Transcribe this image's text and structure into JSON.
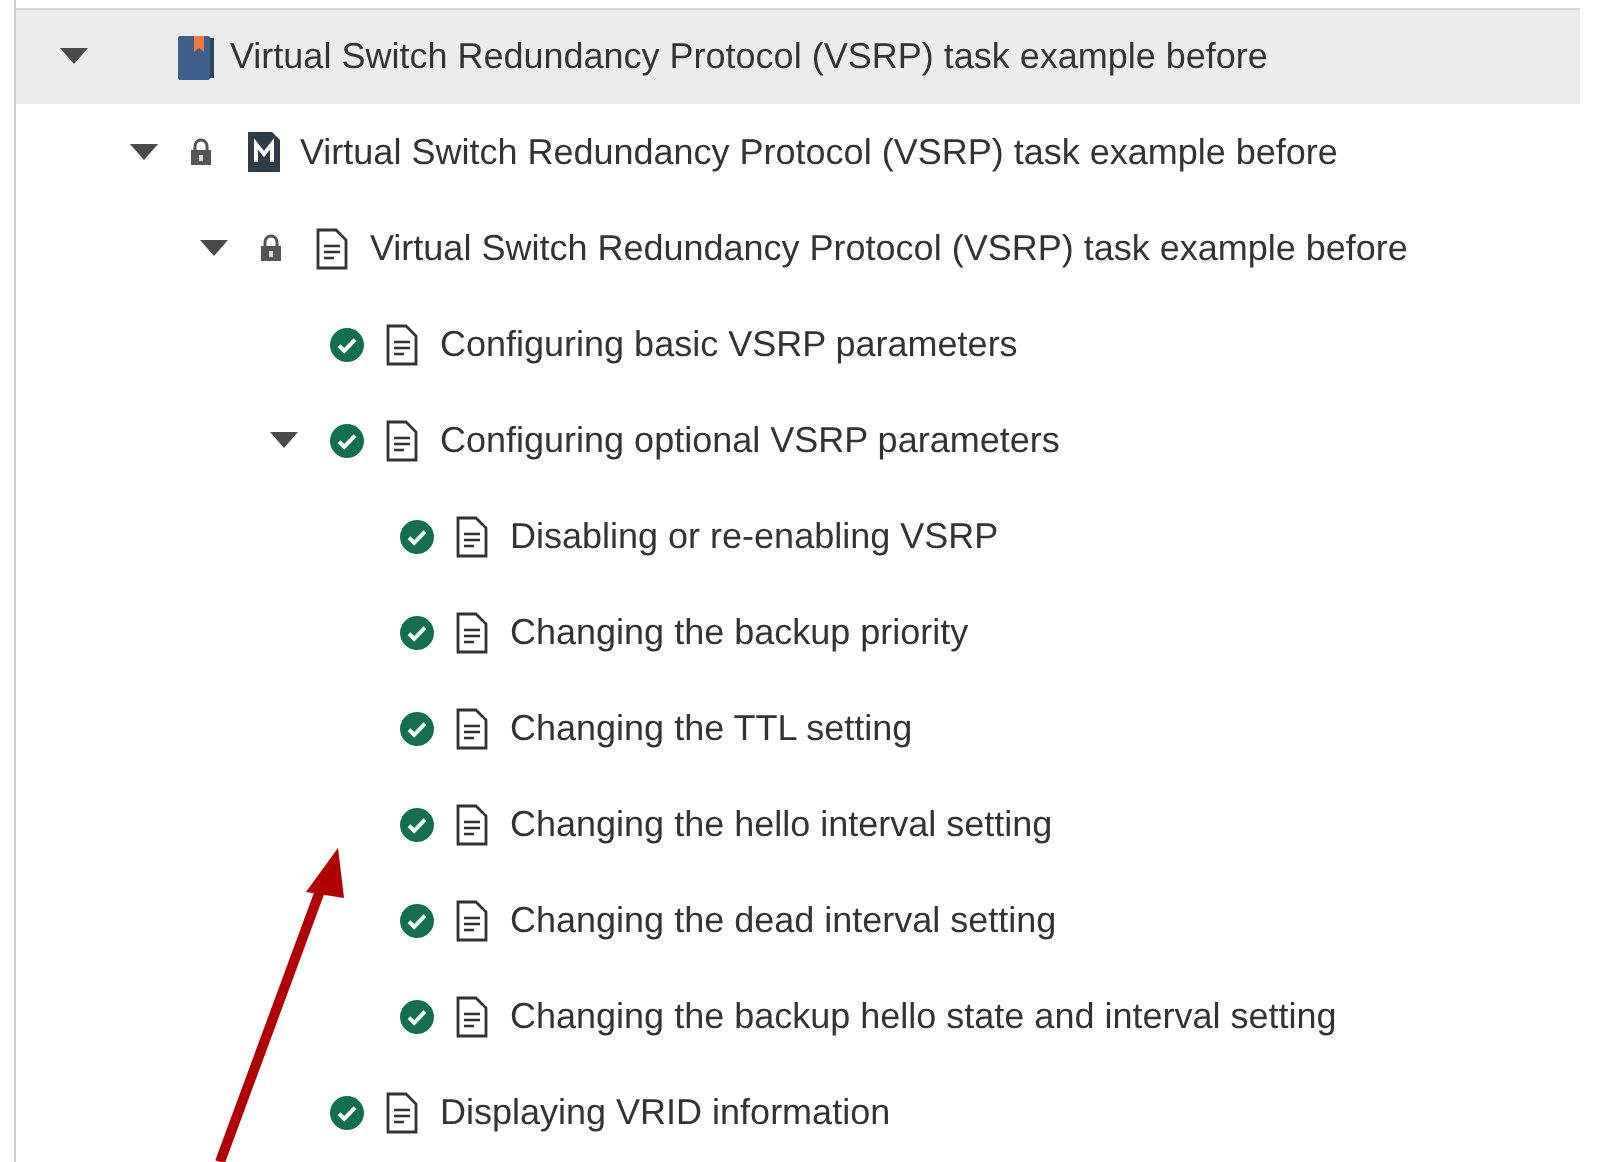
{
  "tree": [
    {
      "label": "Virtual Switch Redundancy Protocol (VSRP) task example before",
      "kind": "book",
      "selected": true,
      "expanded": true,
      "children": [
        {
          "label": "Virtual Switch Redundancy Protocol (VSRP) task example before",
          "kind": "module",
          "locked": true,
          "selected": false,
          "expanded": true,
          "children": [
            {
              "label": "Virtual Switch Redundancy Protocol (VSRP) task example before",
              "kind": "topic",
              "locked": true,
              "selected": false,
              "expanded": true,
              "children": [
                {
                  "label": "Configuring basic VSRP parameters",
                  "kind": "topic",
                  "done": true,
                  "selected": false
                },
                {
                  "label": "Configuring optional VSRP parameters",
                  "kind": "topic",
                  "done": true,
                  "selected": false,
                  "expanded": true,
                  "children": [
                    {
                      "label": "Disabling or re-enabling VSRP",
                      "kind": "topic",
                      "done": true,
                      "selected": false
                    },
                    {
                      "label": "Changing the backup priority",
                      "kind": "topic",
                      "done": true,
                      "selected": false
                    },
                    {
                      "label": "Changing the TTL setting",
                      "kind": "topic",
                      "done": true,
                      "selected": false
                    },
                    {
                      "label": "Changing the hello interval setting",
                      "kind": "topic",
                      "done": true,
                      "selected": false
                    },
                    {
                      "label": "Changing the dead interval setting",
                      "kind": "topic",
                      "done": true,
                      "selected": false
                    },
                    {
                      "label": "Changing the backup hello state and interval setting",
                      "kind": "topic",
                      "done": true,
                      "selected": false
                    }
                  ]
                },
                {
                  "label": "Displaying VRID information",
                  "kind": "topic",
                  "done": true,
                  "selected": false
                }
              ]
            }
          ]
        }
      ]
    }
  ]
}
